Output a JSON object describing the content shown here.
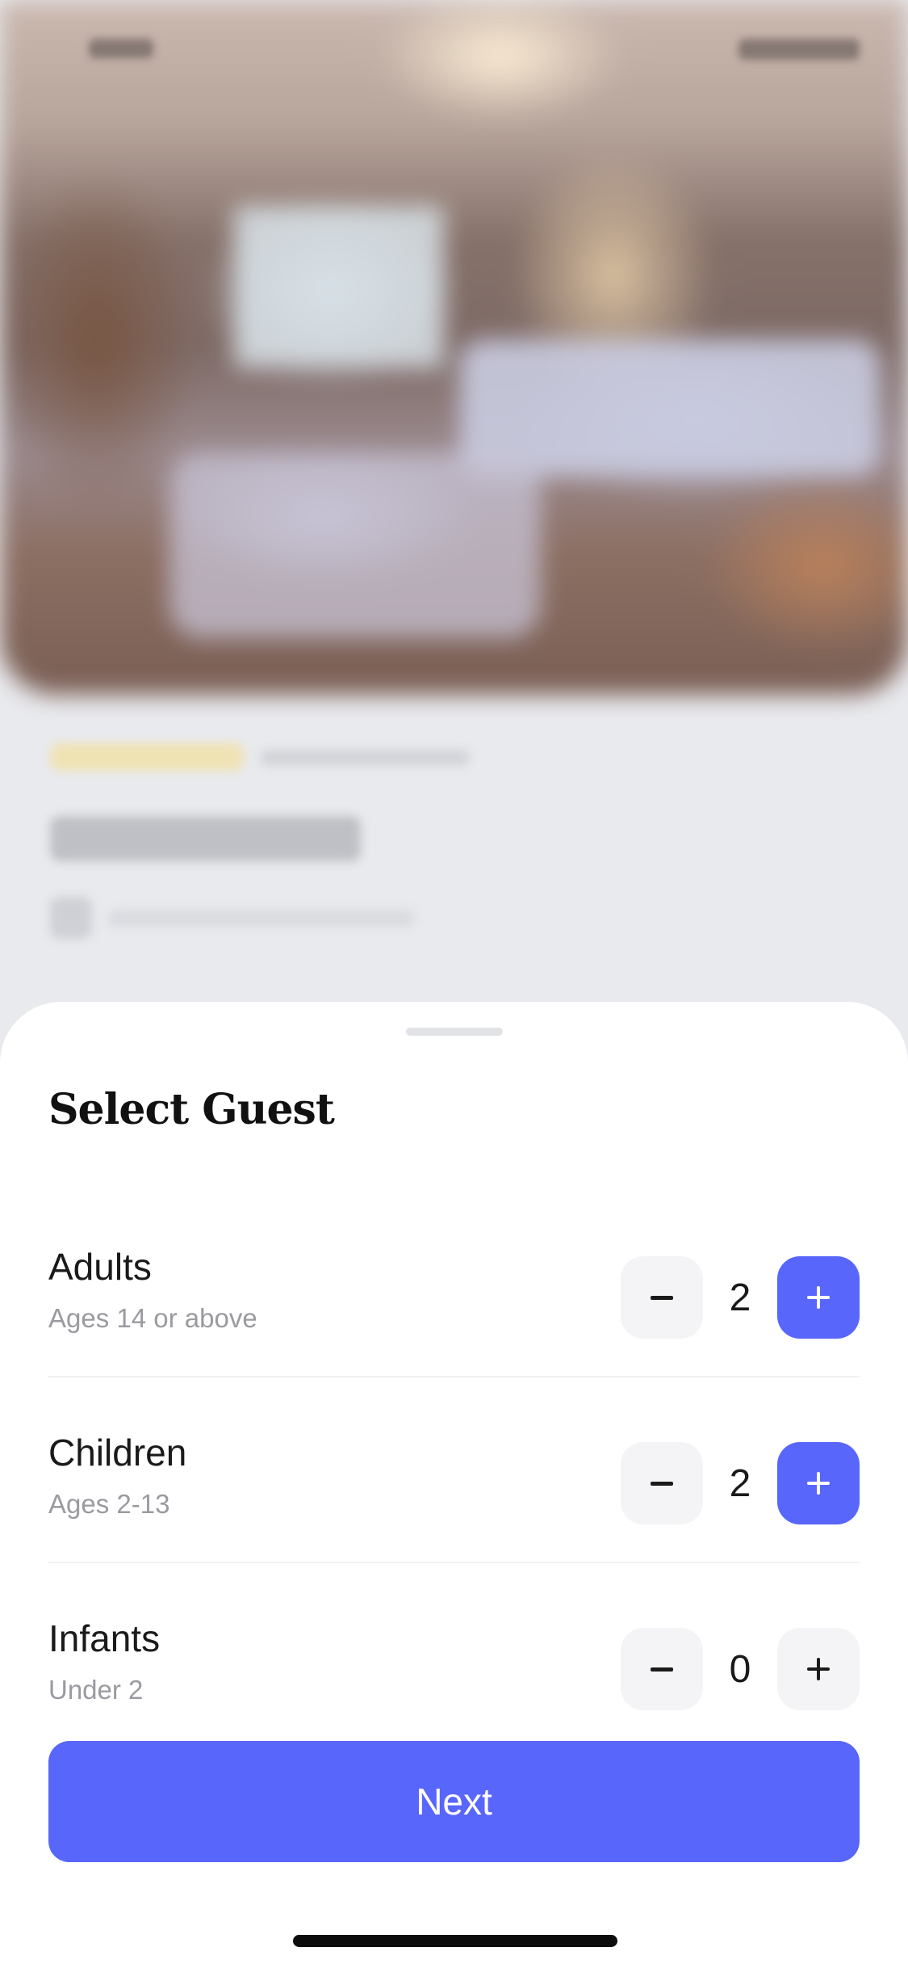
{
  "sheet": {
    "title": "Select Guest",
    "rows": [
      {
        "label": "Adults",
        "sublabel": "Ages 14 or above",
        "value": "2",
        "plus_active": true
      },
      {
        "label": "Children",
        "sublabel": "Ages 2-13",
        "value": "2",
        "plus_active": true
      },
      {
        "label": "Infants",
        "sublabel": "Under 2",
        "value": "0",
        "plus_active": false
      }
    ],
    "next_label": "Next"
  },
  "icons": {
    "decrement": "minus-icon",
    "increment": "plus-icon"
  },
  "colors": {
    "accent": "#5866fb",
    "stepper_bg": "#f4f4f6",
    "sheet_bg": "#ffffff",
    "title_text": "#111111",
    "subtext": "#9a9aa0"
  }
}
